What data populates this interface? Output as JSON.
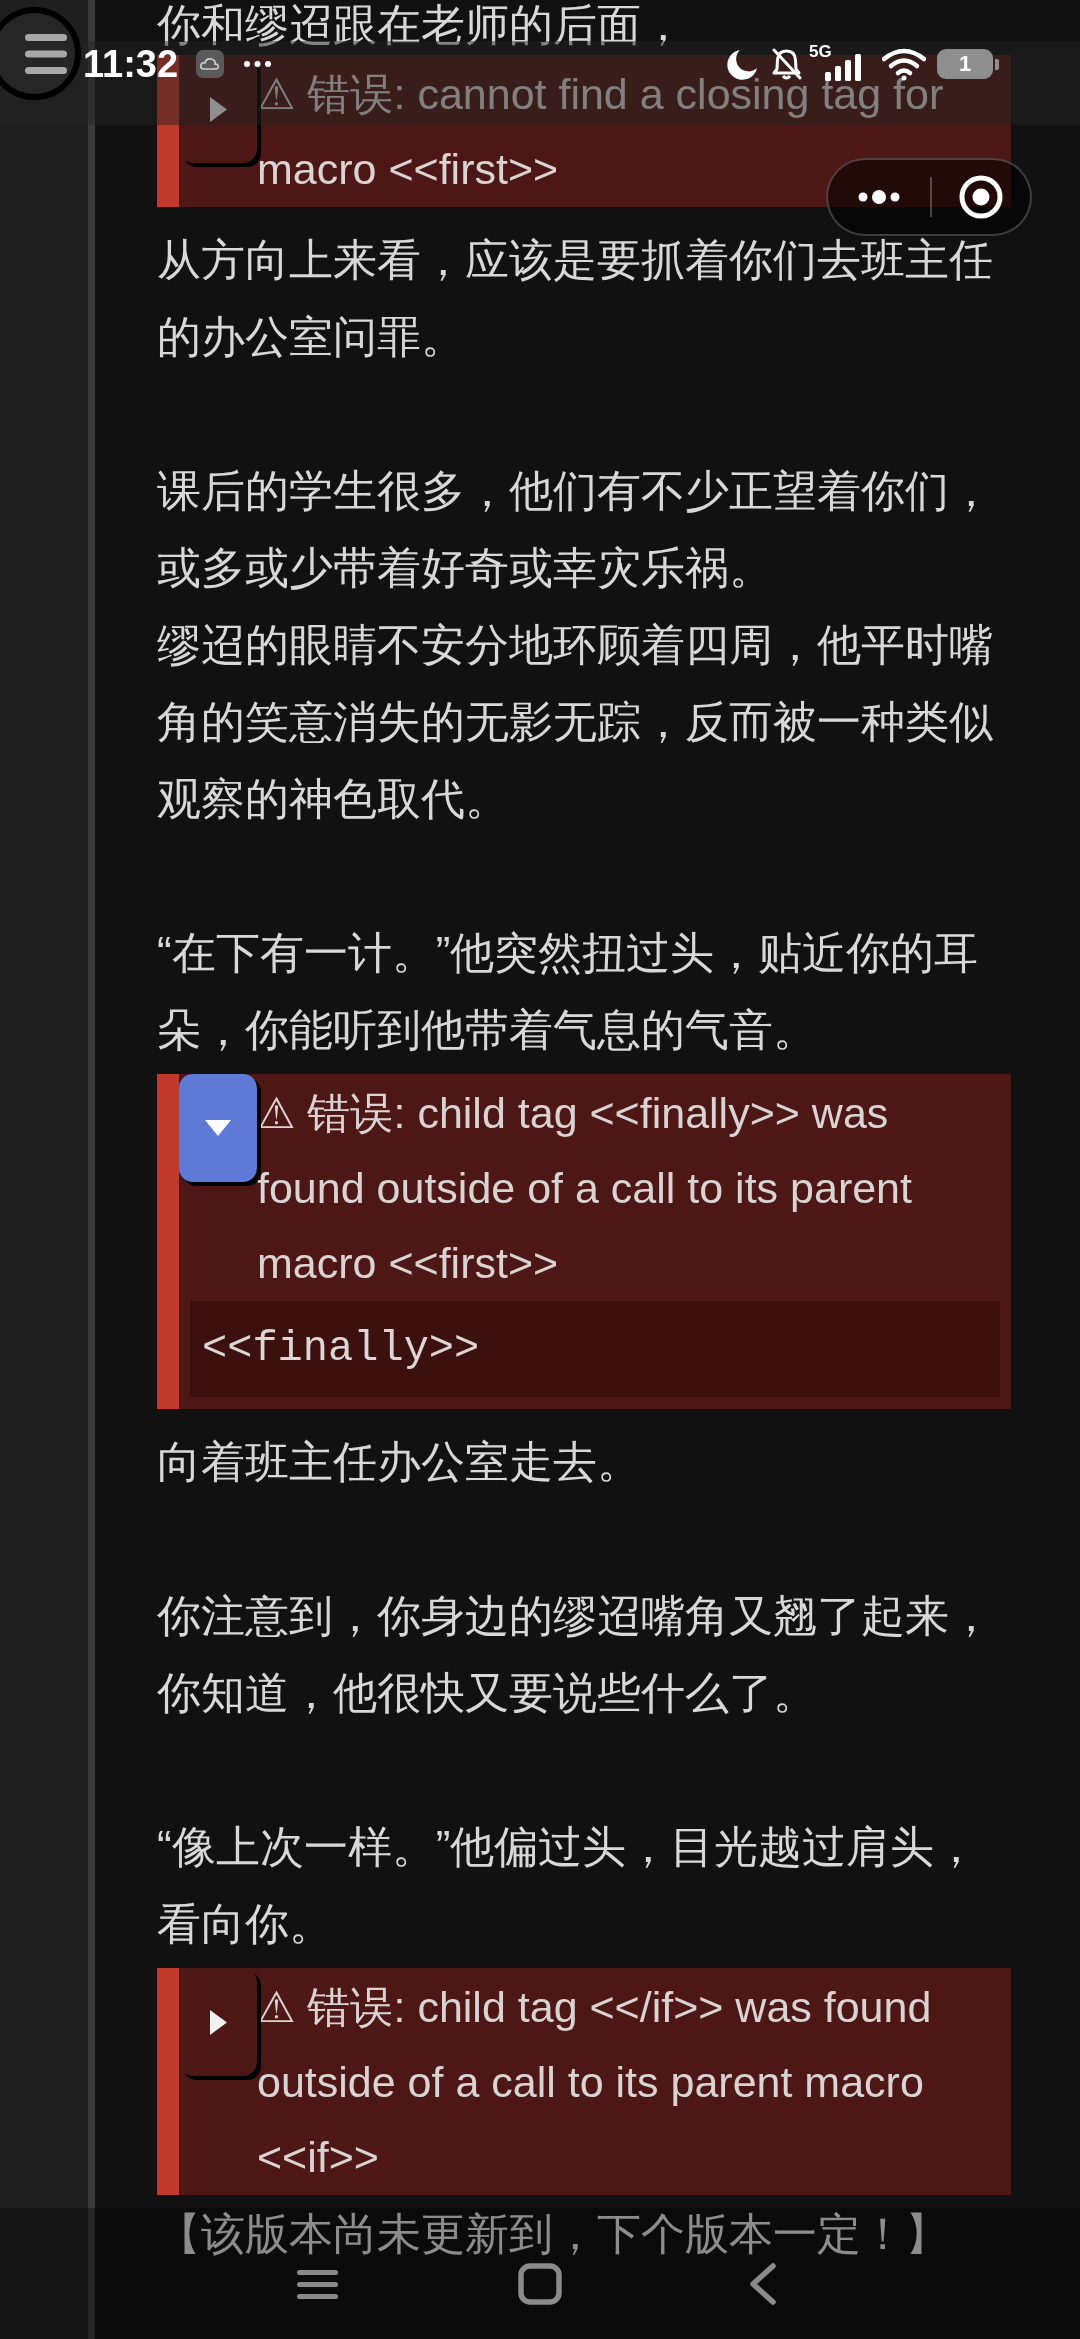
{
  "status_bar": {
    "time": "11:32",
    "network": "5G",
    "battery": "1"
  },
  "story": [
    {
      "kind": "text",
      "text": "你和缪迢跟在老师的后面，"
    },
    {
      "kind": "error",
      "message": "⚠ 错误: cannot find a closing tag for macro <<first>>",
      "expanded": false
    },
    {
      "kind": "text",
      "text": "从方向上来看，应该是要抓着你们去班主任的办公室问罪。"
    },
    {
      "kind": "blank"
    },
    {
      "kind": "text",
      "text": "课后的学生很多，他们有不少正望着你们，或多或少带着好奇或幸灾乐祸。"
    },
    {
      "kind": "text",
      "text": "缪迢的眼睛不安分地环顾着四周，他平时嘴角的笑意消失的无影无踪，反而被一种类似观察的神色取代。"
    },
    {
      "kind": "blank"
    },
    {
      "kind": "text",
      "text": "“在下有一计。”他突然扭过头，贴近你的耳朵，你能听到他带着气息的气音。"
    },
    {
      "kind": "error",
      "message": "⚠ 错误: child tag <<finally>> was found outside of a call to its parent macro <<first>>",
      "expanded": true,
      "source": "<<finally>>"
    },
    {
      "kind": "text",
      "text": "向着班主任办公室走去。"
    },
    {
      "kind": "blank"
    },
    {
      "kind": "text",
      "text": "你注意到，你身边的缪迢嘴角又翘了起来，你知道，他很快又要说些什么了。"
    },
    {
      "kind": "blank"
    },
    {
      "kind": "text",
      "text": "“像上次一样。”他偏过头，目光越过肩头，看向你。"
    },
    {
      "kind": "error",
      "message": "⚠ 错误: child tag <</if>> was found outside of a call to its parent macro <<if>>",
      "expanded": false
    },
    {
      "kind": "text",
      "text": "【该版本尚未更新到，下个版本一定！】"
    }
  ]
}
